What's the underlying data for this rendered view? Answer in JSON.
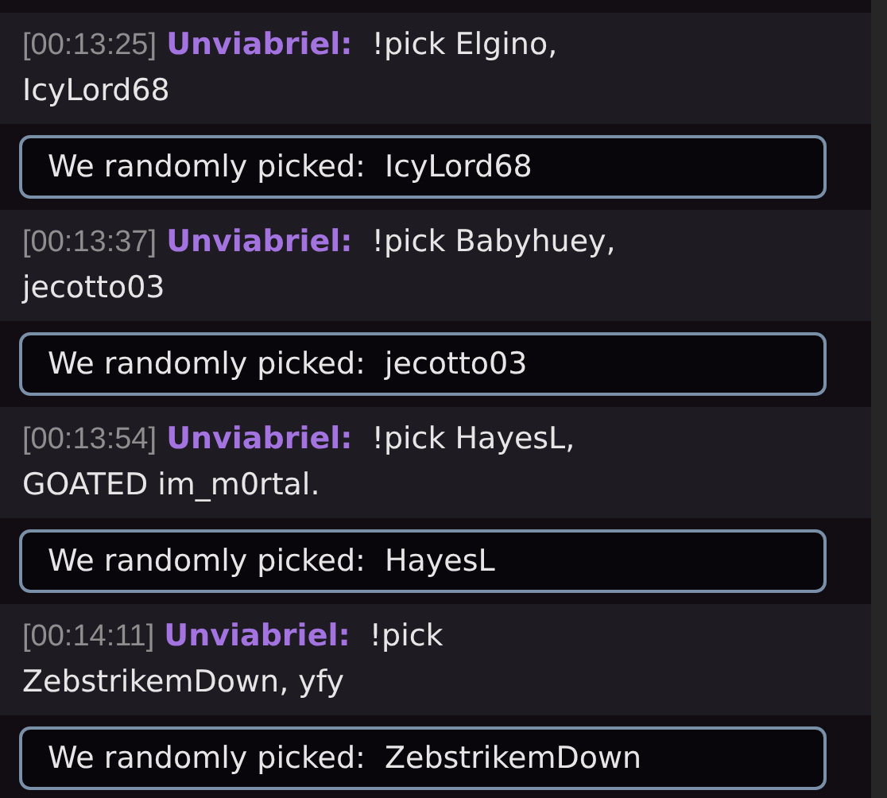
{
  "messages": [
    {
      "timestamp": "[00:13:25]",
      "username": "Unviabriel:",
      "text_lines": [
        "!pick Elgino,",
        "IcyLord68"
      ],
      "reply": "We randomly picked:  IcyLord68"
    },
    {
      "timestamp": "[00:13:37]",
      "username": "Unviabriel:",
      "text_lines": [
        "!pick Babyhuey,",
        "jecotto03"
      ],
      "reply": "We randomly picked:  jecotto03"
    },
    {
      "timestamp": "[00:13:54]",
      "username": "Unviabriel:",
      "text_lines": [
        "!pick HayesL,",
        "GOATED im_m0rtal."
      ],
      "reply": "We randomly picked:  HayesL"
    },
    {
      "timestamp": "[00:14:11]",
      "username": "Unviabriel:",
      "text_lines": [
        "!pick",
        "ZebstrikemDown, yfy"
      ],
      "reply": "We randomly picked:  ZebstrikemDown"
    }
  ]
}
